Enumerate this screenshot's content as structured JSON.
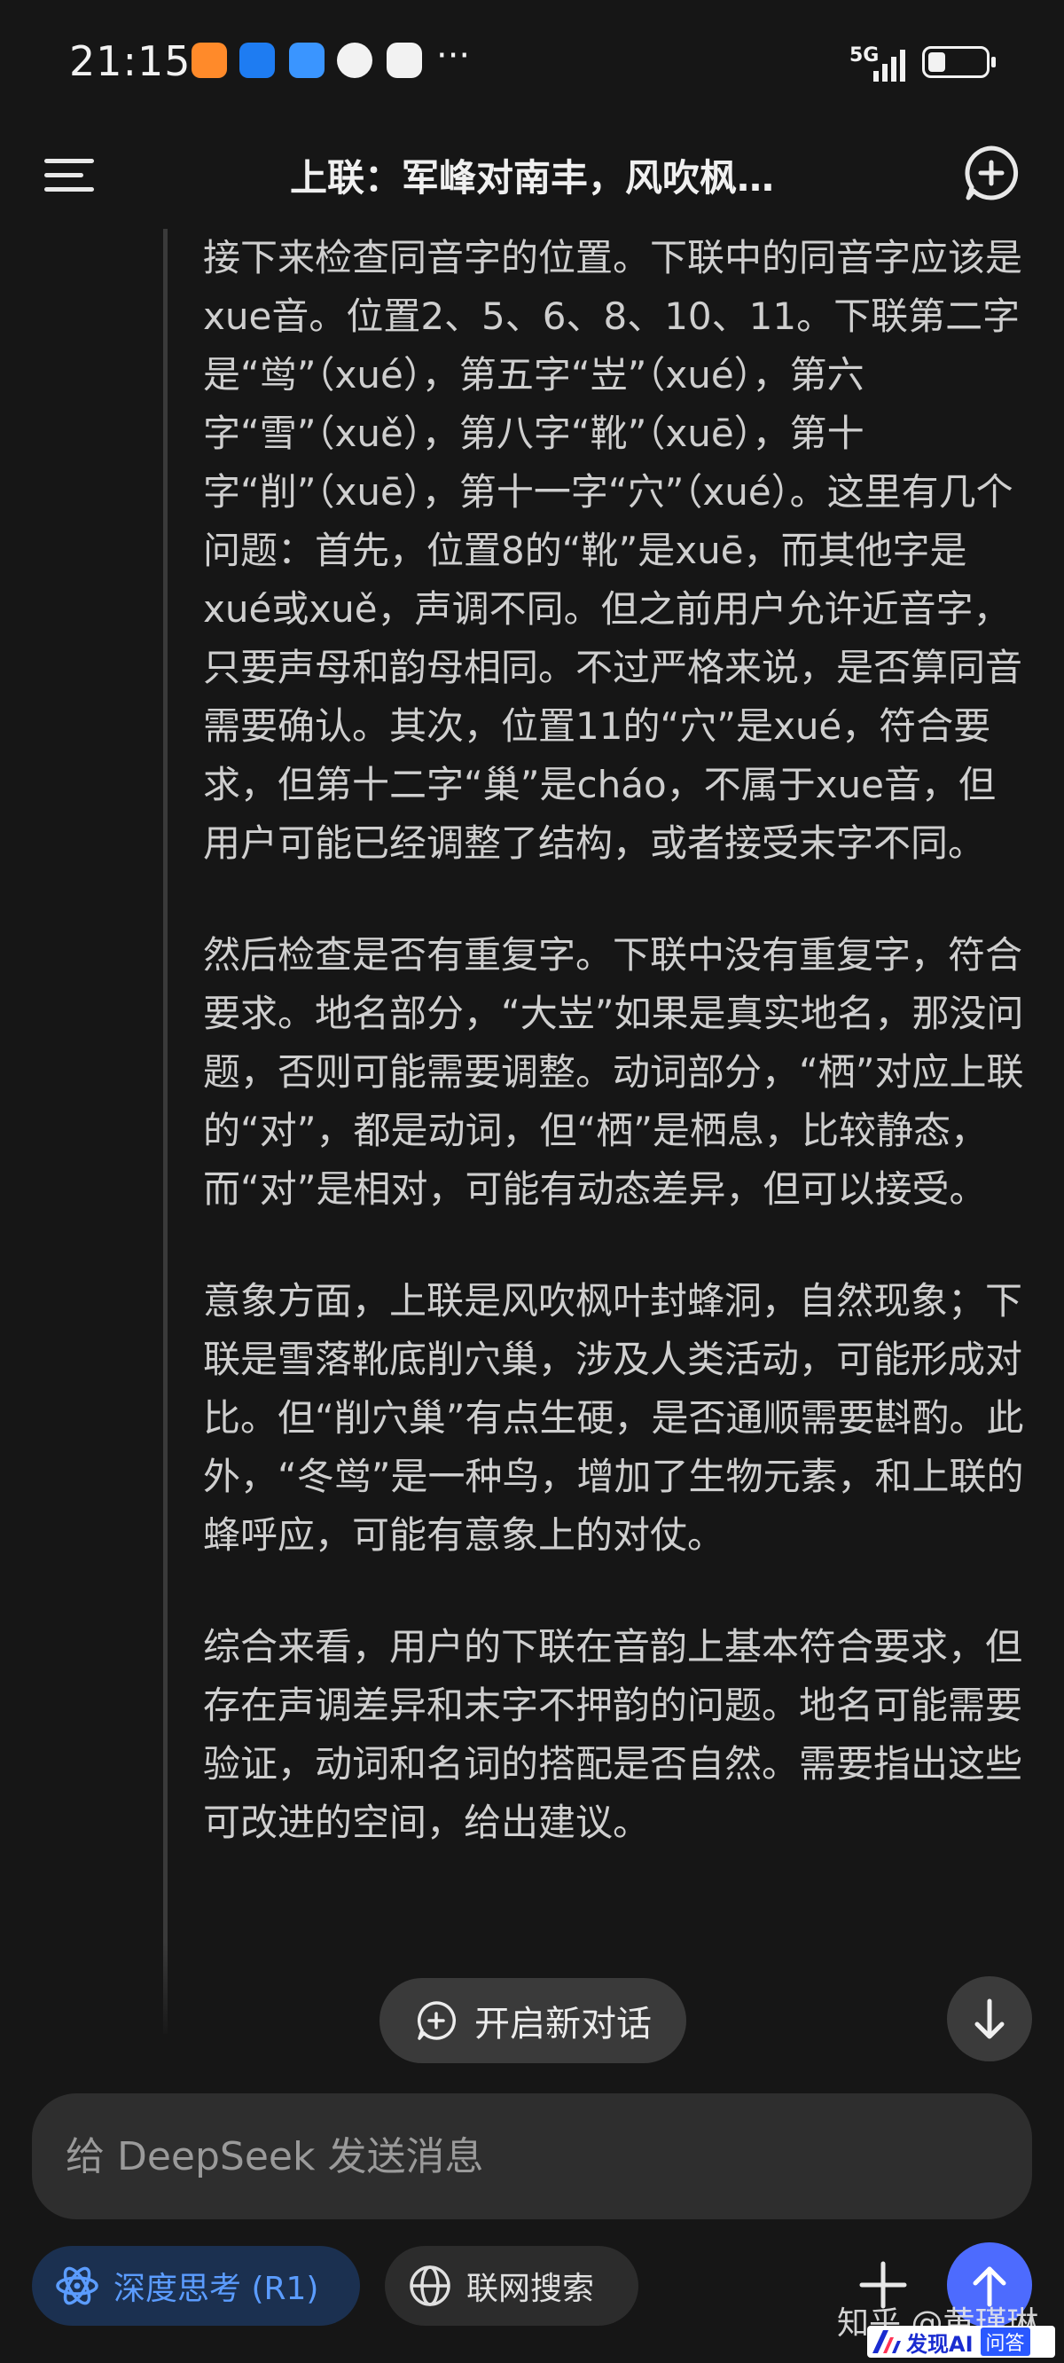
{
  "status": {
    "time": "21:15",
    "network": "5G",
    "signal_bars": 4,
    "battery_level": 0.3,
    "notification_icons": [
      "taobao-icon",
      "alipay-icon",
      "weather-icon",
      "message-icon",
      "app-icon"
    ]
  },
  "header": {
    "title": "上联：军峰对南丰，风吹枫…",
    "menu_icon": "menu-icon",
    "new_chat_icon": "new-chat-icon"
  },
  "thinking": {
    "paragraphs": [
      "接下来检查同音字的位置。下联中的同音字应该是xue音。位置2、5、6、8、10、11。下联第二字是“鸴”（xué），第五字“岦”（xué），第六字“雪”（xuě），第八字“靴”（xuē），第十字“削”（xuē），第十一字“穴”（xué）。这里有几个问题：首先，位置8的“靴”是xuē，而其他字是xué或xuě，声调不同。但之前用户允许近音字，只要声母和韵母相同。不过严格来说，是否算同音需要确认。其次，位置11的“穴”是xué，符合要求，但第十二字“巢”是cháo，不属于xue音，但用户可能已经调整了结构，或者接受末字不同。",
      "然后检查是否有重复字。下联中没有重复字，符合要求。地名部分，“大岦”如果是真实地名，那没问题，否则可能需要调整。动词部分，“栖”对应上联的“对”，都是动词，但“栖”是栖息，比较静态，而“对”是相对，可能有动态差异，但可以接受。",
      "意象方面，上联是风吹枫叶封蜂洞，自然现象；下联是雪落靴底削穴巢，涉及人类活动，可能形成对比。但“削穴巢”有点生硬，是否通顺需要斟酌。此外，“冬鸴”是一种鸟，增加了生物元素，和上联的蜂呼应，可能有意象上的对仗。",
      "综合来看，用户的下联在音韵上基本符合要求，但存在声调差异和末字不押韵的问题。地名可能需要验证，动词和名词的搭配是否自然。需要指出这些可改进的空间，给出建议。"
    ]
  },
  "overlay": {
    "new_chat_label": "开启新对话"
  },
  "composer": {
    "placeholder": "给 DeepSeek 发送消息",
    "deep_think_label": "深度思考 (R1)",
    "web_search_label": "联网搜索",
    "accent_color": "#4d6bfe"
  },
  "watermark": {
    "text": "知乎 @黄瑾琳",
    "logo_text": "发现AI",
    "logo_badge": "问答"
  }
}
